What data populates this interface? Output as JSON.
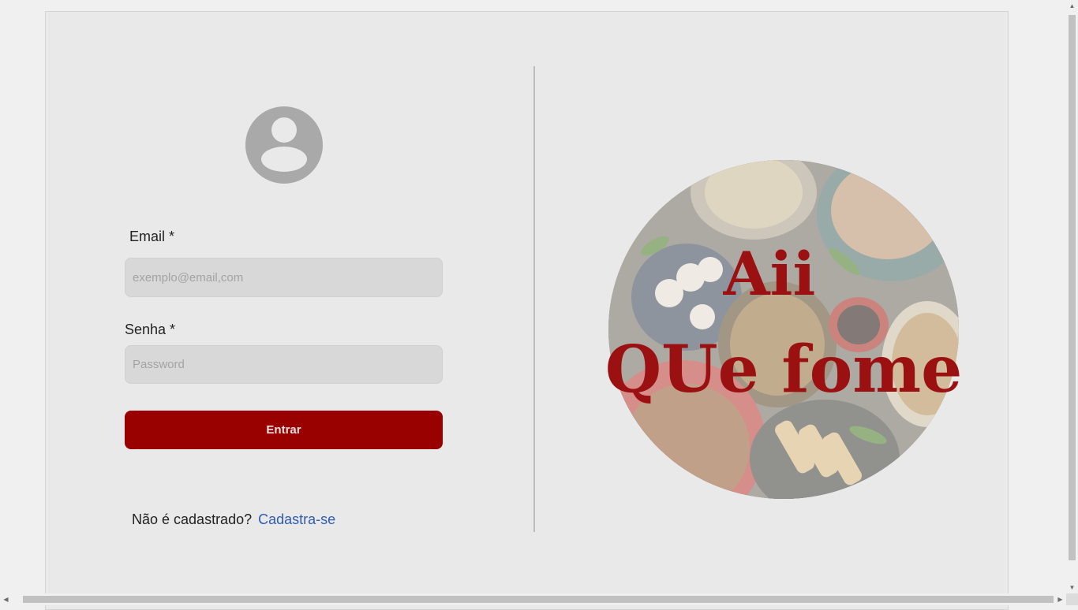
{
  "login": {
    "email_label": "Email *",
    "email_placeholder": "exemplo@email,com",
    "email_value": "",
    "password_label": "Senha *",
    "password_placeholder": "Password",
    "password_value": "",
    "submit_label": "Entrar",
    "signup_prompt": "Não é cadastrado?",
    "signup_link": "Cadastra-se"
  },
  "logo": {
    "line1": "Aii",
    "line2": "QUe fome"
  },
  "icons": {
    "avatar": "user-avatar-icon"
  },
  "colors": {
    "accent": "#990000",
    "logo_text": "#9b1010",
    "link": "#2f5bb3",
    "background": "#e9e9e9"
  }
}
